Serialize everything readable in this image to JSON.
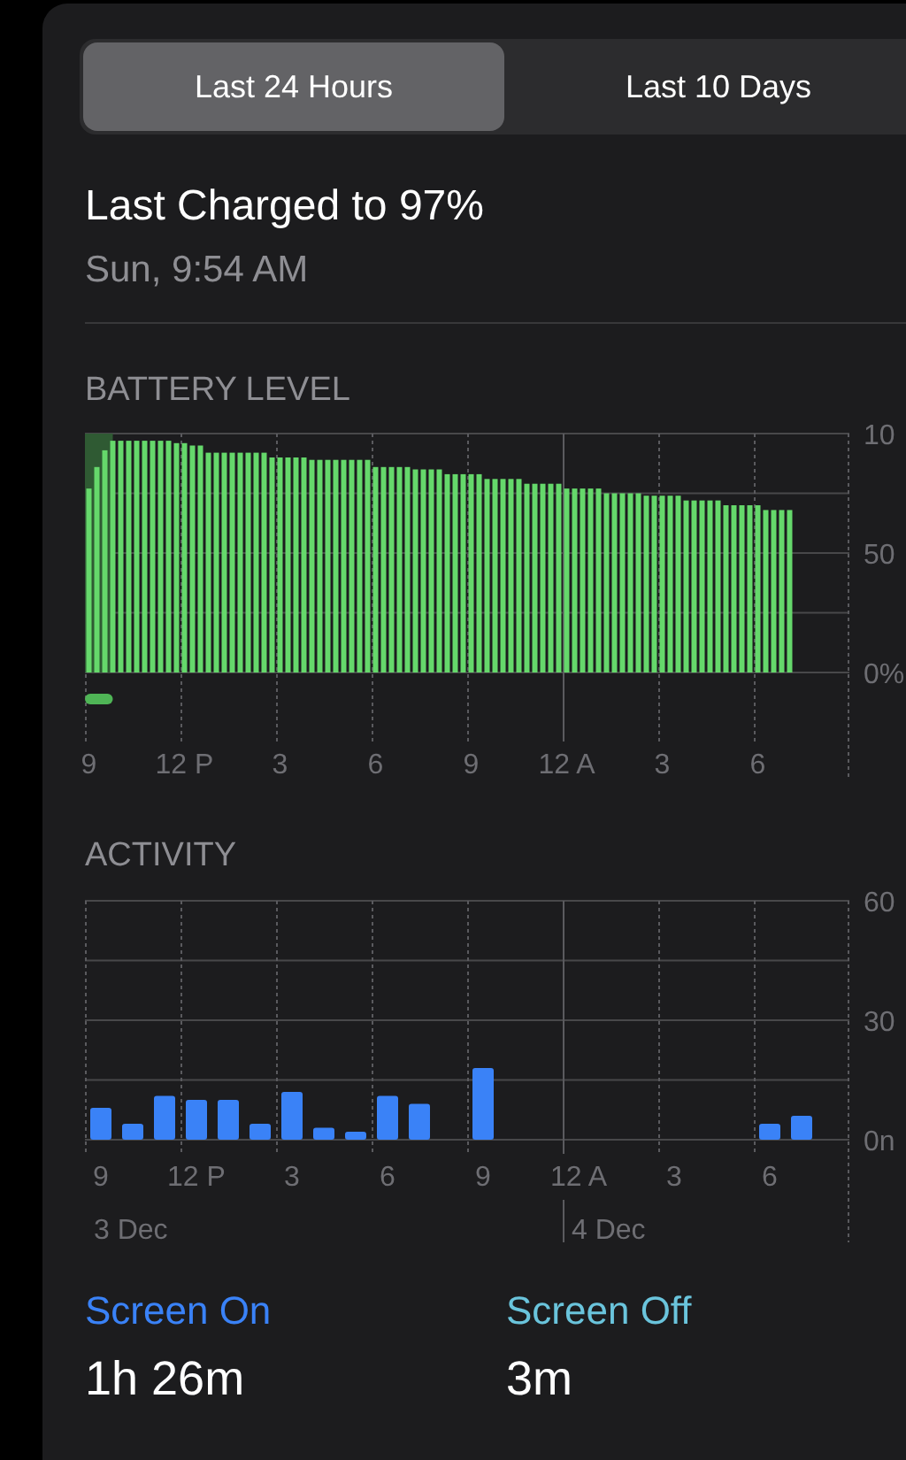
{
  "segmented_control": [
    {
      "label": "Last 24 Hours",
      "selected": true
    },
    {
      "label": "Last 10 Days",
      "selected": false
    }
  ],
  "last_charged": {
    "title": "Last Charged to 97%",
    "time": "Sun, 9:54 AM"
  },
  "battery_level": {
    "heading": "BATTERY LEVEL",
    "charging_indicator": true,
    "chart_data": {
      "type": "bar",
      "ylim": [
        0,
        100
      ],
      "categories": [
        "9",
        null,
        null,
        null,
        null,
        null,
        null,
        null,
        null,
        null,
        null,
        null,
        "12 P",
        null,
        null,
        null,
        null,
        null,
        null,
        null,
        null,
        null,
        null,
        null,
        "3",
        null,
        null,
        null,
        null,
        null,
        null,
        null,
        null,
        null,
        null,
        null,
        "6",
        null,
        null,
        null,
        null,
        null,
        null,
        null,
        null,
        null,
        null,
        null,
        "9",
        null,
        null,
        null,
        null,
        null,
        null,
        null,
        null,
        null,
        null,
        null,
        "12 A",
        null,
        null,
        null,
        null,
        null,
        null,
        null,
        null,
        null,
        null,
        null,
        "3",
        null,
        null,
        null,
        null,
        null,
        null,
        null,
        null,
        null,
        null,
        null,
        "6",
        null,
        null,
        null,
        null,
        null,
        null,
        null,
        null,
        null,
        null,
        null
      ],
      "values": [
        77,
        86,
        93,
        97,
        97,
        97,
        97,
        97,
        97,
        97,
        97,
        96,
        96,
        95,
        95,
        92,
        92,
        92,
        92,
        92,
        92,
        92,
        92,
        90,
        90,
        90,
        90,
        90,
        89,
        89,
        89,
        89,
        89,
        89,
        89,
        89,
        86,
        86,
        86,
        86,
        86,
        85,
        85,
        85,
        85,
        83,
        83,
        83,
        83,
        83,
        81,
        81,
        81,
        81,
        81,
        79,
        79,
        79,
        79,
        79,
        77,
        77,
        77,
        77,
        77,
        75,
        75,
        75,
        75,
        75,
        74,
        74,
        74,
        74,
        74,
        72,
        72,
        72,
        72,
        72,
        70,
        70,
        70,
        70,
        70,
        68,
        68,
        68,
        68,
        null,
        null,
        null,
        null,
        null,
        null,
        null
      ],
      "yticks": [
        {
          "value": 50,
          "label": "50"
        },
        {
          "value": 0,
          "label": "0%"
        }
      ]
    },
    "top_axis_label": "10"
  },
  "activity": {
    "heading": "ACTIVITY",
    "chart_data": {
      "type": "bar",
      "ylim": [
        0,
        60
      ],
      "categories": [
        "9",
        null,
        null,
        "12 P",
        null,
        null,
        "3",
        null,
        null,
        "6",
        null,
        null,
        "9",
        null,
        null,
        "12 A",
        null,
        null,
        "3",
        null,
        null,
        "6",
        null,
        null
      ],
      "values": [
        8,
        4,
        11,
        10,
        10,
        4,
        12,
        3,
        2,
        11,
        9,
        0,
        18,
        0,
        0,
        0,
        0,
        0,
        0,
        0,
        0,
        4,
        6,
        null
      ],
      "yticks": [
        {
          "value": 60,
          "label": "60"
        },
        {
          "value": 30,
          "label": "30"
        },
        {
          "value": 0,
          "label": "0n"
        }
      ],
      "annotations": [
        "3 Dec",
        "4 Dec"
      ]
    }
  },
  "usage": [
    {
      "label": "Screen On",
      "value": "1h 26m",
      "color": "#3a82f7"
    },
    {
      "label": "Screen Off",
      "value": "3m",
      "color": "#6ac4dc"
    }
  ]
}
